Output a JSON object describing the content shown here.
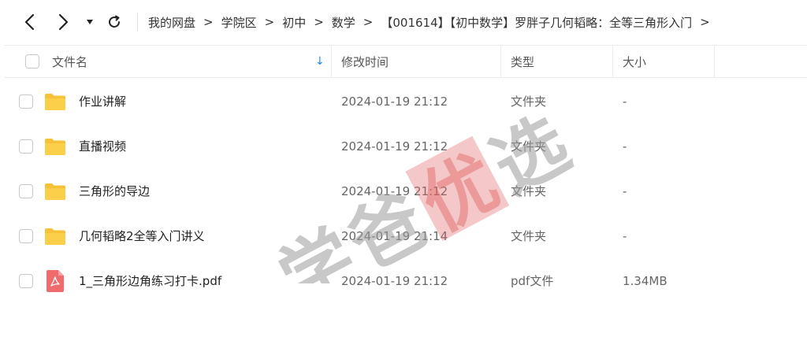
{
  "breadcrumb": [
    "我的网盘",
    "学院区",
    "初中",
    "数学",
    "【001614】【初中数学】罗胖子几何韬略：全等三角形入门"
  ],
  "breadcrumb_separator": ">",
  "header": {
    "name": "文件名",
    "modified": "修改时间",
    "type": "类型",
    "size": "大小",
    "sort_arrow": "↓"
  },
  "rows": [
    {
      "name": "作业讲解",
      "modified": "2024-01-19 21:12",
      "type": "文件夹",
      "size": "-",
      "icon": "folder-icon"
    },
    {
      "name": "直播视频",
      "modified": "2024-01-19 21:12",
      "type": "文件夹",
      "size": "-",
      "icon": "folder-icon"
    },
    {
      "name": "三角形的导边",
      "modified": "2024-01-19 21:12",
      "type": "文件夹",
      "size": "-",
      "icon": "folder-icon"
    },
    {
      "name": "几何韬略2全等入门讲义",
      "modified": "2024-01-19 21:14",
      "type": "文件夹",
      "size": "-",
      "icon": "folder-icon"
    },
    {
      "name": "1_三角形边角练习打卡.pdf",
      "modified": "2024-01-19 21:12",
      "type": "pdf文件",
      "size": "1.34MB",
      "icon": "pdf-icon"
    }
  ],
  "watermark": {
    "text1": "学",
    "text2": "爸",
    "text3": "优",
    "text4": "选"
  },
  "colors": {
    "folder": "#f7c23a",
    "folder_dark": "#e8ad1f",
    "pdf": "#f06b6b",
    "accent": "#1e88e5",
    "watermark": "#9a9a9a",
    "watermark_red": "#e06060"
  }
}
